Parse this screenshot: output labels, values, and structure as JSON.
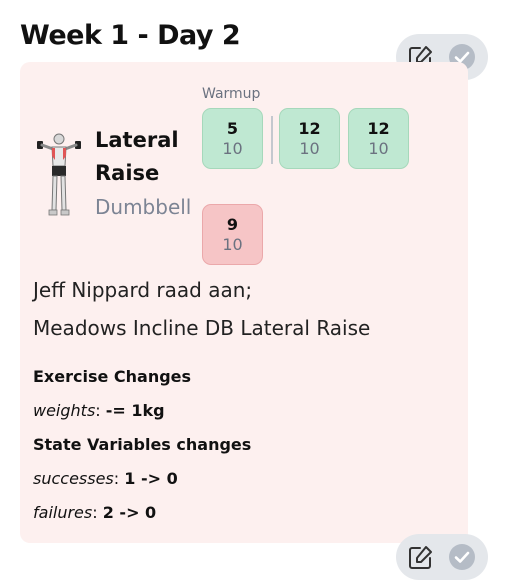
{
  "day_title": "Week 1 - Day 2",
  "exercise": {
    "name": "Lateral Raise",
    "equipment": "Dumbbell",
    "warmup_label": "Warmup",
    "warmup_set": {
      "reps": "5",
      "target": "10",
      "status": "success"
    },
    "sets": [
      {
        "reps": "12",
        "target": "10",
        "status": "success"
      },
      {
        "reps": "12",
        "target": "10",
        "status": "success"
      },
      {
        "reps": "9",
        "target": "10",
        "status": "failure"
      }
    ],
    "notes": [
      "Jeff Nippard raad aan;",
      "Meadows Incline DB Lateral Raise"
    ],
    "changes": {
      "exercise_heading": "Exercise Changes",
      "exercise_items": [
        {
          "key": "weights",
          "sep": ": ",
          "value": "-= 1kg"
        }
      ],
      "state_heading": "State Variables changes",
      "state_items": [
        {
          "key": "successes",
          "sep": ": ",
          "value": "1 -> 0"
        },
        {
          "key": "failures",
          "sep": ": ",
          "value": "2 -> 0"
        }
      ]
    }
  },
  "icons": {
    "edit": "edit-icon",
    "check": "check-circle-icon"
  },
  "colors": {
    "card_bg": "#fdf0ef",
    "success": "#bfe8d2",
    "failure": "#f6c5c6",
    "pill_bg": "#e4e7eb"
  }
}
